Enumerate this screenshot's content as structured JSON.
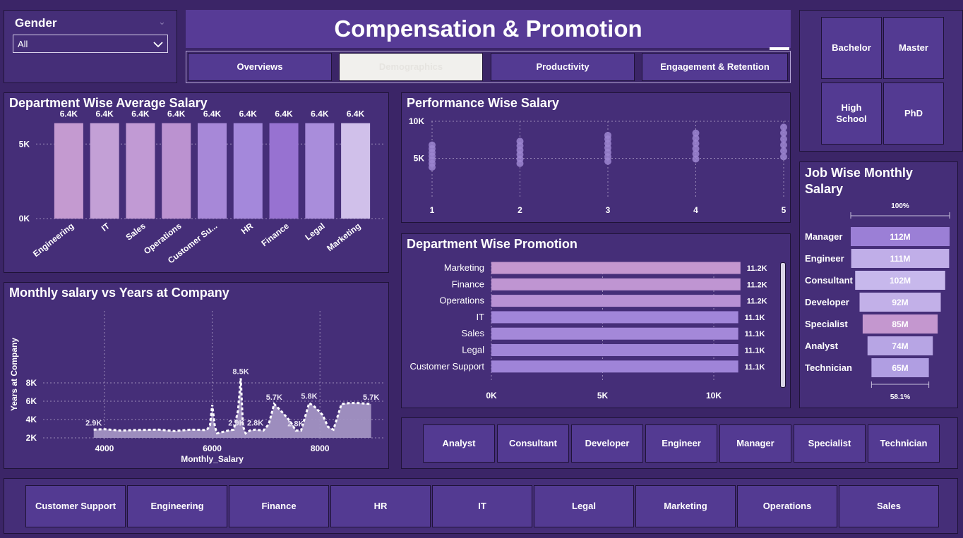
{
  "gender_slicer": {
    "title": "Gender",
    "value": "All"
  },
  "header": {
    "title": "Compensation & Promotion",
    "nav": [
      "Overviews",
      "Demographics",
      "Productivity",
      "Engagement & Retention"
    ],
    "active_nav": 1
  },
  "education_slicer": {
    "items": [
      "Bachelor",
      "Master",
      "High School",
      "PhD"
    ]
  },
  "job_slicer": {
    "items": [
      "Analyst",
      "Consultant",
      "Developer",
      "Engineer",
      "Manager",
      "Specialist",
      "Technician"
    ]
  },
  "department_slicer": {
    "items": [
      "Customer Support",
      "Engineering",
      "Finance",
      "HR",
      "IT",
      "Legal",
      "Marketing",
      "Operations",
      "Sales"
    ]
  },
  "colors": {
    "background": "#3b2567",
    "panel": "#452e78",
    "button": "#533a92",
    "accent": "#9a7bd6"
  },
  "chart_data": [
    {
      "id": "dept_avg_salary",
      "type": "bar",
      "title": "Department Wise Average Salary",
      "categories": [
        "Engineering",
        "IT",
        "Sales",
        "Operations",
        "Customer Su...",
        "HR",
        "Finance",
        "Legal",
        "Marketing"
      ],
      "values": [
        6400,
        6400,
        6400,
        6400,
        6400,
        6400,
        6400,
        6400,
        6400
      ],
      "data_labels": [
        "6.4K",
        "6.4K",
        "6.4K",
        "6.4K",
        "6.4K",
        "6.4K",
        "6.4K",
        "6.4K",
        "6.4K"
      ],
      "yticks": [
        "0K",
        "5K"
      ],
      "ylim": [
        0,
        7000
      ],
      "colors": [
        "#c49ad0",
        "#c3a0d6",
        "#c19ad4",
        "#bb92d0",
        "#a788d8",
        "#a488db",
        "#9772d1",
        "#a98ddb",
        "#d0c0ea"
      ],
      "grid": true
    },
    {
      "id": "performance_salary",
      "type": "scatter",
      "title": "Performance Wise Salary",
      "x": [
        1,
        2,
        3,
        4,
        5
      ],
      "points": [
        [
          1,
          3800
        ],
        [
          1,
          4300
        ],
        [
          1,
          4800
        ],
        [
          1,
          5300
        ],
        [
          1,
          5800
        ],
        [
          1,
          6300
        ],
        [
          1,
          6800
        ],
        [
          2,
          4300
        ],
        [
          2,
          4900
        ],
        [
          2,
          5500
        ],
        [
          2,
          6100
        ],
        [
          2,
          6700
        ],
        [
          2,
          7300
        ],
        [
          3,
          4600
        ],
        [
          3,
          5200
        ],
        [
          3,
          5800
        ],
        [
          3,
          6400
        ],
        [
          3,
          7000
        ],
        [
          3,
          7600
        ],
        [
          3,
          8100
        ],
        [
          4,
          4900
        ],
        [
          4,
          5600
        ],
        [
          4,
          6300
        ],
        [
          4,
          7000
        ],
        [
          4,
          7700
        ],
        [
          4,
          8400
        ],
        [
          5,
          5200
        ],
        [
          5,
          6000
        ],
        [
          5,
          6800
        ],
        [
          5,
          7600
        ],
        [
          5,
          8400
        ],
        [
          5,
          9200
        ]
      ],
      "yticks": [
        "5K",
        "10K"
      ],
      "ylim": [
        0,
        10000
      ],
      "grid": true
    },
    {
      "id": "dept_promotion",
      "type": "bar",
      "orientation": "horizontal",
      "title": "Department Wise Promotion",
      "categories": [
        "Marketing",
        "Finance",
        "Operations",
        "IT",
        "Sales",
        "Legal",
        "Customer Support"
      ],
      "values": [
        11200,
        11200,
        11200,
        11100,
        11100,
        11100,
        11100
      ],
      "data_labels": [
        "11.2K",
        "11.2K",
        "11.2K",
        "11.1K",
        "11.1K",
        "11.1K",
        "11.1K"
      ],
      "xticks": [
        "0K",
        "5K",
        "10K"
      ],
      "xlim": [
        0,
        12000
      ],
      "colors": [
        "#c497cf",
        "#bf95d2",
        "#b891d4",
        "#a186d9",
        "#a488d9",
        "#a085d7",
        "#9f84d8"
      ],
      "grid": true
    },
    {
      "id": "salary_vs_years",
      "type": "area",
      "title": "Monthly salary vs Years at Company",
      "xlabel": "Monthly_Salary",
      "ylabel": "Years at Company",
      "xticks": [
        "4000",
        "6000",
        "8000"
      ],
      "yticks": [
        "2K",
        "4K",
        "6K",
        "8K"
      ],
      "xlim": [
        3400,
        9400
      ],
      "ylim": [
        2000,
        8800
      ],
      "x": [
        3800,
        4000,
        4300,
        4600,
        5000,
        5300,
        5600,
        5900,
        5960,
        6000,
        6050,
        6090,
        6300,
        6400,
        6480,
        6530,
        6570,
        6620,
        6700,
        6800,
        6950,
        7050,
        7150,
        7300,
        7450,
        7550,
        7650,
        7800,
        7900,
        8050,
        8150,
        8250,
        8400,
        8550,
        8700,
        8950
      ],
      "y": [
        2900,
        2950,
        2800,
        2850,
        2900,
        2750,
        2900,
        2850,
        3400,
        5600,
        3200,
        2500,
        2800,
        2900,
        5000,
        8500,
        3300,
        2500,
        2800,
        2900,
        2800,
        3500,
        5700,
        4800,
        3800,
        2800,
        2800,
        5800,
        5400,
        4500,
        3200,
        2900,
        5700,
        5800,
        5800,
        5700
      ],
      "data_labels": [
        {
          "x": 3800,
          "y": 2900,
          "text": "2.9K"
        },
        {
          "x": 6530,
          "y": 8500,
          "text": "8.5K"
        },
        {
          "x": 6450,
          "y": 2900,
          "text": "2.9K"
        },
        {
          "x": 6800,
          "y": 2900,
          "text": "2.8K"
        },
        {
          "x": 7150,
          "y": 5700,
          "text": "5.7K"
        },
        {
          "x": 7550,
          "y": 2800,
          "text": "2.8K"
        },
        {
          "x": 7800,
          "y": 5800,
          "text": "5.8K"
        },
        {
          "x": 8950,
          "y": 5700,
          "text": "5.7K"
        }
      ],
      "grid": true
    },
    {
      "id": "job_monthly_salary",
      "type": "funnel",
      "title": "Job Wise Monthly Salary",
      "categories": [
        "Manager",
        "Engineer",
        "Consultant",
        "Developer",
        "Specialist",
        "Analyst",
        "Technician"
      ],
      "values": [
        112,
        111,
        102,
        92,
        85,
        74,
        65
      ],
      "data_labels": [
        "112M",
        "111M",
        "102M",
        "92M",
        "85M",
        "74M",
        "65M"
      ],
      "top_percent": "100%",
      "bottom_percent": "58.1%",
      "colors": [
        "#9b7fd6",
        "#c0aee8",
        "#c7b8ec",
        "#c2b0e8",
        "#c497cf",
        "#b7a5e4",
        "#b09ee2"
      ]
    }
  ]
}
